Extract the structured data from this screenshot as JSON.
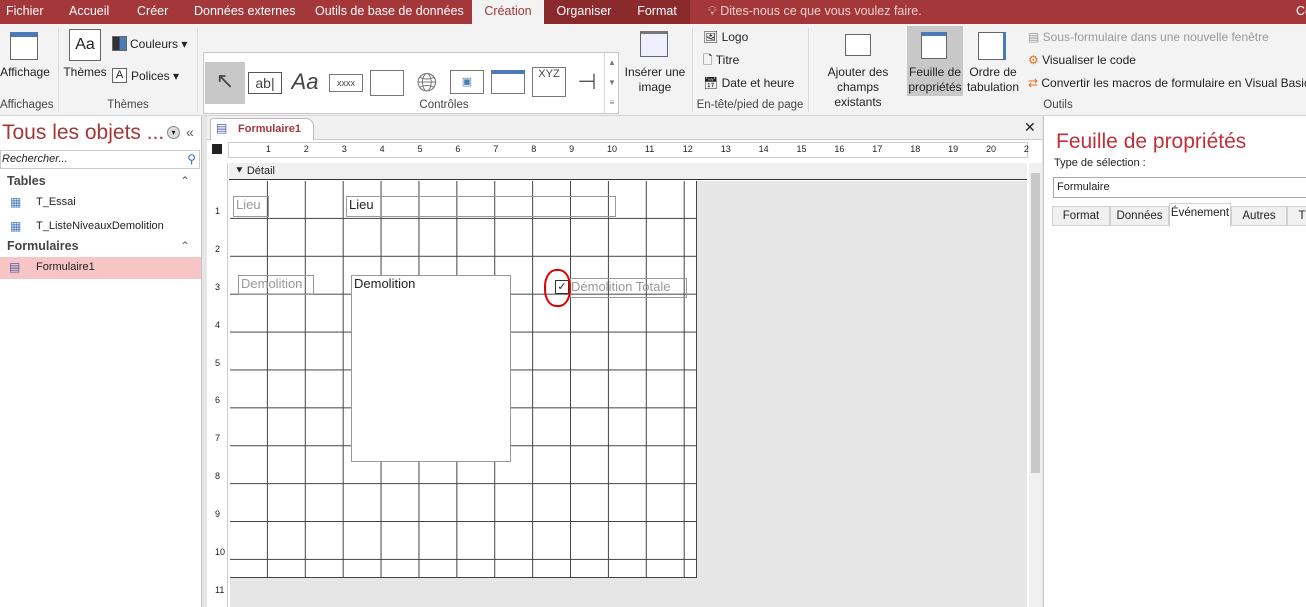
{
  "tabs": [
    "Fichier",
    "Accueil",
    "Créer",
    "Données externes",
    "Outils de base de données",
    "Création",
    "Organiser",
    "Format"
  ],
  "tell_me": "Dites-nous ce que vous voulez faire.",
  "user_initials": "Co",
  "ribbon": {
    "affichage": "Affichage",
    "affichages_group": "Affichages",
    "themes": "Thèmes",
    "couleurs": "Couleurs",
    "polices": "Polices",
    "themes_group": "Thèmes",
    "controls": [
      "ab|",
      "Aa",
      "xxxx",
      "XYZ"
    ],
    "controles_group": "Contrôles",
    "inserer_image": "Insérer une image",
    "logo": "Logo",
    "titre": "Titre",
    "date_heure": "Date et heure",
    "entete_group": "En-tête/pied de page",
    "ajouter_champs": "Ajouter des champs existants",
    "feuille_props": "Feuille de propriétés",
    "ordre_tab": "Ordre de tabulation",
    "sous_form": "Sous-formulaire dans une nouvelle fenêtre",
    "visualiser_code": "Visualiser le code",
    "convertir_macros": "Convertir les macros de formulaire en Visual Basic",
    "outils_group": "Outils"
  },
  "nav": {
    "title": "Tous les objets ...",
    "search_placeholder": "Rechercher...",
    "sections": [
      {
        "label": "Tables",
        "items": [
          "T_Essai",
          "T_ListeNiveauxDemolition"
        ]
      },
      {
        "label": "Formulaires",
        "items": [
          "Formulaire1"
        ]
      }
    ]
  },
  "document": {
    "tab": "Formulaire1",
    "section": "Détail",
    "ruler_h": [
      "1",
      "2",
      "3",
      "4",
      "5",
      "6",
      "7",
      "8",
      "9",
      "10",
      "11",
      "12",
      "13",
      "14",
      "15",
      "16",
      "17",
      "18",
      "19",
      "20",
      "2"
    ],
    "ruler_v": [
      "1",
      "2",
      "3",
      "4",
      "5",
      "6",
      "7",
      "8",
      "9",
      "10",
      "11"
    ],
    "controls": {
      "lieu_label": "Lieu",
      "lieu_field": "Lieu",
      "demolition_label": "Demolition",
      "demolition_list": "Demolition",
      "checkbox_label": "Démolition Totale",
      "checkbox_checked": true
    }
  },
  "properties": {
    "title": "Feuille de propriétés",
    "selection_type_label": "Type de sélection :",
    "selection_value": "Formulaire",
    "tabs": [
      "Format",
      "Données",
      "Événement",
      "Autres",
      "T"
    ],
    "active_tab": "Événement"
  },
  "colors": {
    "accent": "#a4373a",
    "selected_nav": "#f8c5c6",
    "annotation": "#e00000"
  }
}
